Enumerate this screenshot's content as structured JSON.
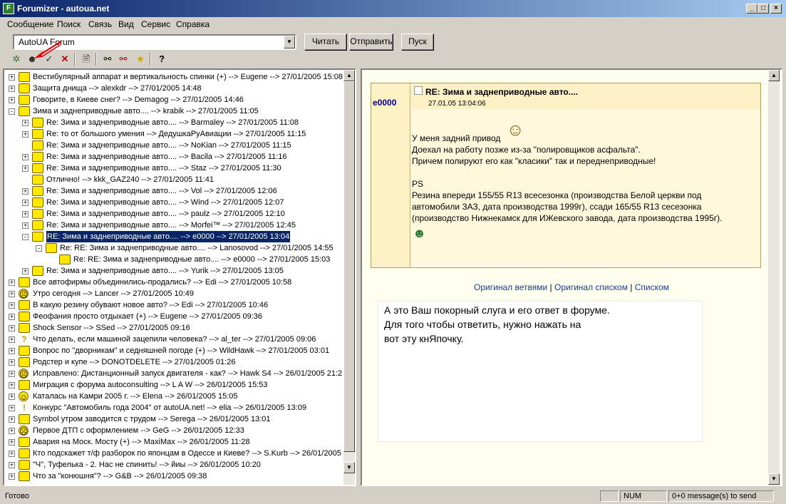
{
  "window": {
    "title": "Forumizer - autoua.net"
  },
  "menu": [
    "Сообщение",
    "Поиск",
    "Связь",
    "Вид",
    "Сервис",
    "Справка"
  ],
  "toolbar": {
    "forum_select": "AutoUA Forum",
    "read_button": "Читать",
    "send_button": "Отправить",
    "start_button": "Пуск"
  },
  "tree": [
    "Вестибулярный аппарат и вертикальность спинки (+) --> Eugene --> 27/01/2005 15:08",
    "Защита днища --> alexkdr --> 27/01/2005 14:48",
    "Говорите, в Киеве снег? --> Demagog --> 27/01/2005 14:46",
    "Зима и заднеприводные авто.... --> krabik --> 27/01/2005 11:05",
    "Re: Зима и заднеприводные авто.... --> Barmaley --> 27/01/2005 11:08",
    "Re: то от большого умения --> ДедушкаРуАвиации --> 27/01/2005 11:15",
    "Re: Зима и заднеприводные авто.... --> NoKian --> 27/01/2005 11:15",
    "Re: Зима и заднеприводные авто.... --> Bacila --> 27/01/2005 11:16",
    "Re: Зима и заднеприводные авто.... --> Staz --> 27/01/2005 11:30",
    "Отлично! --> kkk_GAZ240 --> 27/01/2005 11:41",
    "Re: Зима и заднеприводные авто.... --> Vol --> 27/01/2005 12:06",
    "Re: Зима и заднеприводные авто.... --> Wind --> 27/01/2005 12:07",
    "Re: Зима и заднеприводные авто.... --> paulz --> 27/01/2005 12:10",
    "Re: Зима и заднеприводные авто.... --> Morfei™ --> 27/01/2005 12:45",
    "RE: Зима и заднеприводные авто.... --> e0000 --> 27/01/2005 13:04",
    "Re: RE: Зима и заднеприводные авто.... --> Lanosovod --> 27/01/2005 14:55",
    "Re: RE: Зима и заднеприводные авто.... --> e0000 --> 27/01/2005 15:03",
    "Re: Зима и заднеприводные авто.... --> Yurik --> 27/01/2005 13:05",
    "Все автофирмы объединились-продались? --> Edi --> 27/01/2005 10:58",
    "Утро сегодня --> Lancer --> 27/01/2005 10:49",
    "В какую резину обувают новое авто? --> Edi --> 27/01/2005 10:46",
    "Феофания просто отдыхает (+) --> Eugene --> 27/01/2005 09:36",
    "Shock Sensor --> SSed --> 27/01/2005 09:16",
    "Что делать, если машиной зацепили человека? --> al_ter --> 27/01/2005 09:06",
    "Вопрос по \"дворникам\" и седняшней погоде (+) --> WildHawk --> 27/01/2005 03:01",
    "Родстер и купе --> DONOTDELETE --> 27/01/2005 01:26",
    "Исправлено: Дистанционный запуск двигателя - как? --> Hawk S4 --> 26/01/2005 21:2",
    "Миграция с форума autoconsulting --> L A W --> 26/01/2005 15:53",
    "Каталась на Камри 2005 г. --> Elena --> 26/01/2005 15:05",
    "Конкурс \"Автомобиль года 2004\" от autoUA.net! --> elia --> 26/01/2005 13:09",
    "Symbol утром заводится с трудом --> Serega --> 26/01/2005 13:01",
    "Первое ДТП с оформлением --> GeG --> 26/01/2005 12:33",
    "Авария на Моск. Мосту (+) --> MaxiMax --> 26/01/2005 11:28",
    "Кто подскажет т/ф разборок по японцам в Одессе и Киеве? --> S.Kurb --> 26/01/2005",
    "\"Ч\", Туфелька - 2. Нас не спинить! --> йиы --> 26/01/2005 10:20",
    "Что за \"конюшня\"? --> G&B --> 26/01/2005 09:38"
  ],
  "message": {
    "author": "e0000",
    "subject": "RE: Зима и заднеприводные авто....",
    "date": "27.01.05 13:04:06",
    "body": [
      "У меня задний привод",
      "Доехал на работу позже из-за \"полировщиков асфальта\".",
      "Причем полируют его как \"класики\" так и переднеприводные!",
      "PS",
      "Резина впереди 155/55 R13 всесезонка (производства Белой церкви под",
      "автомобили ЗАЗ, дата производства 1999г), ссади 165/55 R13 сесезонка",
      "(производство Нижнекамск для ИЖевского завода, дата производства 1995г)."
    ],
    "links": [
      "Оригинал ветвями",
      "Оригинал списком",
      "Списком"
    ],
    "link_sep": "|"
  },
  "annotation": [
    "А это Ваш покорный слуга и его ответ в форуме.",
    "Для того чтобы ответить, нужно нажать на",
    "вот эту кнЯпочку."
  ],
  "status": {
    "left": "Готово",
    "num": "NUM",
    "queue": "0+0 message(s) to send"
  }
}
